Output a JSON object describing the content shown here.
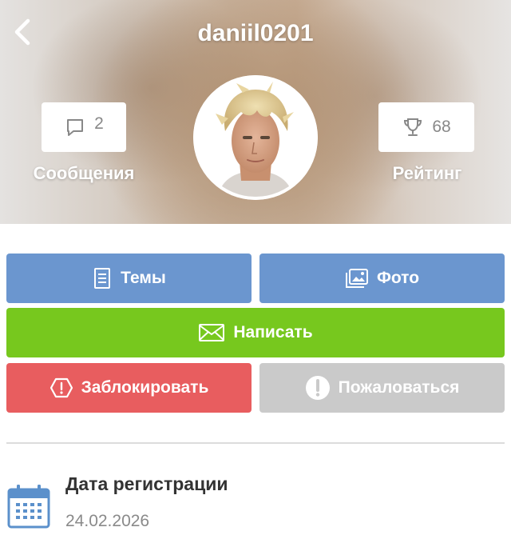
{
  "header": {
    "title": "daniil0201",
    "back_icon": "chevron-left-icon",
    "messages": {
      "count": "2",
      "label": "Сообщения",
      "icon": "speech-bubble-icon"
    },
    "rating": {
      "value": "68",
      "label": "Рейтинг",
      "icon": "trophy-icon"
    },
    "avatar_alt": "avatar"
  },
  "actions": {
    "topics_label": "Темы",
    "photo_label": "Фото",
    "write_label": "Написать",
    "block_label": "Заблокировать",
    "report_label": "Пожаловаться"
  },
  "colors": {
    "blue": "#6b96cf",
    "green": "#77c81e",
    "red": "#e85d5f",
    "gray": "#cacaca",
    "calendar": "#5b90cb"
  },
  "info": {
    "registration_title": "Дата регистрации",
    "registration_date": "24.02.2026"
  }
}
